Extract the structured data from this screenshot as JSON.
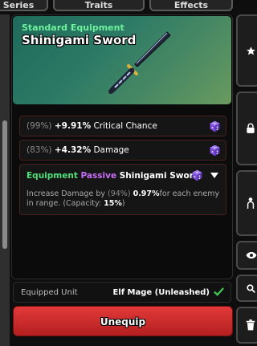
{
  "top_tabs": [
    "Series",
    "Traits",
    "Effects"
  ],
  "item": {
    "rarity": "Standard Equipment",
    "name": "Shinigami Sword"
  },
  "stats": [
    {
      "roll": "(99%)",
      "value": "+9.91%",
      "label": "Critical Chance"
    },
    {
      "roll": "(83%)",
      "value": "+4.32%",
      "label": "Damage"
    }
  ],
  "passive": {
    "title_part1": "Equipment",
    "title_part2": "Passive",
    "title_part3": "Shinigami Sword",
    "desc_before": "Increase Damage by",
    "desc_roll": "(94%)",
    "desc_value": "0.97%",
    "desc_middle": "for each enemy in range. (Capacity:",
    "desc_capacity": "15%",
    "desc_end": ")"
  },
  "equipped": {
    "label": "Equipped Unit",
    "value": "Elf Mage (Unleashed)"
  },
  "unequip_label": "Unequip",
  "colors": {
    "rarity": "#6ff29a",
    "header_gradient_start": "#1f6a5a",
    "header_gradient_end": "#6a9a5e",
    "button_red": "#d22e2e",
    "check_green": "#3ec64f",
    "dice_purple": "#8b5cf6"
  },
  "icons": [
    "star-icon",
    "lock-icon",
    "figure-icon",
    "eye-icon",
    "search-icon",
    "trash-icon",
    "dice-icon",
    "chevron-down-icon",
    "check-icon"
  ]
}
